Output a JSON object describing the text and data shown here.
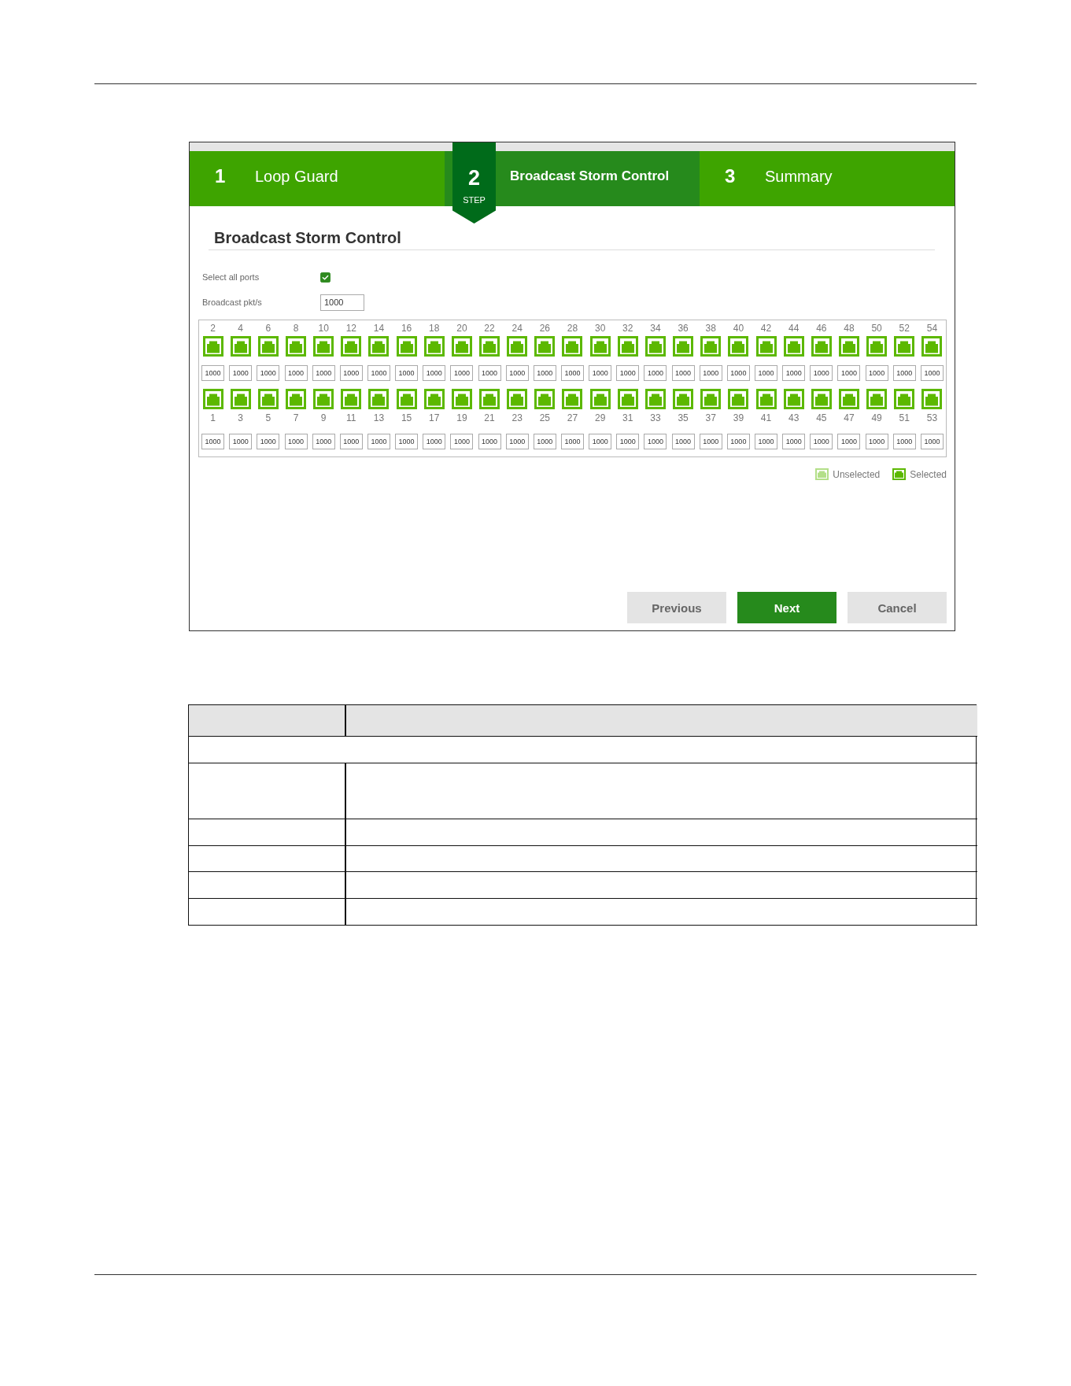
{
  "step_caption": "STEP",
  "steps": [
    {
      "number": "1",
      "label": "Loop Guard",
      "selected": false
    },
    {
      "number": "2",
      "label": "Broadcast Storm Control",
      "selected": true
    },
    {
      "number": "3",
      "label": "Summary",
      "selected": false
    }
  ],
  "section_title": "Broadcast Storm Control",
  "select_all": {
    "label": "Select all ports",
    "checked": true
  },
  "broadcast_rate": {
    "label": "Broadcast pkt/s",
    "value": "1000"
  },
  "port_rows": [
    {
      "kind": "upper",
      "ports": [
        {
          "number": "2",
          "value": "1000",
          "selected": true
        },
        {
          "number": "4",
          "value": "1000",
          "selected": true
        },
        {
          "number": "6",
          "value": "1000",
          "selected": true
        },
        {
          "number": "8",
          "value": "1000",
          "selected": true
        },
        {
          "number": "10",
          "value": "1000",
          "selected": true
        },
        {
          "number": "12",
          "value": "1000",
          "selected": true
        },
        {
          "number": "14",
          "value": "1000",
          "selected": true
        },
        {
          "number": "16",
          "value": "1000",
          "selected": true
        },
        {
          "number": "18",
          "value": "1000",
          "selected": true
        },
        {
          "number": "20",
          "value": "1000",
          "selected": true
        },
        {
          "number": "22",
          "value": "1000",
          "selected": true
        },
        {
          "number": "24",
          "value": "1000",
          "selected": true
        },
        {
          "number": "26",
          "value": "1000",
          "selected": true
        },
        {
          "number": "28",
          "value": "1000",
          "selected": true
        },
        {
          "number": "30",
          "value": "1000",
          "selected": true
        },
        {
          "number": "32",
          "value": "1000",
          "selected": true
        },
        {
          "number": "34",
          "value": "1000",
          "selected": true
        },
        {
          "number": "36",
          "value": "1000",
          "selected": true
        },
        {
          "number": "38",
          "value": "1000",
          "selected": true
        },
        {
          "number": "40",
          "value": "1000",
          "selected": true
        },
        {
          "number": "42",
          "value": "1000",
          "selected": true
        },
        {
          "number": "44",
          "value": "1000",
          "selected": true
        },
        {
          "number": "46",
          "value": "1000",
          "selected": true
        },
        {
          "number": "48",
          "value": "1000",
          "selected": true
        },
        {
          "number": "50",
          "value": "1000",
          "selected": true
        },
        {
          "number": "52",
          "value": "1000",
          "selected": true
        },
        {
          "number": "54",
          "value": "1000",
          "selected": true
        }
      ]
    },
    {
      "kind": "lower",
      "ports": [
        {
          "number": "1",
          "value": "1000",
          "selected": true
        },
        {
          "number": "3",
          "value": "1000",
          "selected": true
        },
        {
          "number": "5",
          "value": "1000",
          "selected": true
        },
        {
          "number": "7",
          "value": "1000",
          "selected": true
        },
        {
          "number": "9",
          "value": "1000",
          "selected": true
        },
        {
          "number": "11",
          "value": "1000",
          "selected": true
        },
        {
          "number": "13",
          "value": "1000",
          "selected": true
        },
        {
          "number": "15",
          "value": "1000",
          "selected": true
        },
        {
          "number": "17",
          "value": "1000",
          "selected": true
        },
        {
          "number": "19",
          "value": "1000",
          "selected": true
        },
        {
          "number": "21",
          "value": "1000",
          "selected": true
        },
        {
          "number": "23",
          "value": "1000",
          "selected": true
        },
        {
          "number": "25",
          "value": "1000",
          "selected": true
        },
        {
          "number": "27",
          "value": "1000",
          "selected": true
        },
        {
          "number": "29",
          "value": "1000",
          "selected": true
        },
        {
          "number": "31",
          "value": "1000",
          "selected": true
        },
        {
          "number": "33",
          "value": "1000",
          "selected": true
        },
        {
          "number": "35",
          "value": "1000",
          "selected": true
        },
        {
          "number": "37",
          "value": "1000",
          "selected": true
        },
        {
          "number": "39",
          "value": "1000",
          "selected": true
        },
        {
          "number": "41",
          "value": "1000",
          "selected": true
        },
        {
          "number": "43",
          "value": "1000",
          "selected": true
        },
        {
          "number": "45",
          "value": "1000",
          "selected": true
        },
        {
          "number": "47",
          "value": "1000",
          "selected": true
        },
        {
          "number": "49",
          "value": "1000",
          "selected": true
        },
        {
          "number": "51",
          "value": "1000",
          "selected": true
        },
        {
          "number": "53",
          "value": "1000",
          "selected": true
        }
      ]
    }
  ],
  "legend": [
    {
      "label": "Unselected",
      "kind": "unselected"
    },
    {
      "label": "Selected",
      "kind": "selected"
    }
  ],
  "buttons": [
    {
      "label": "Previous",
      "kind": "secondary"
    },
    {
      "label": "Next",
      "kind": "primary"
    },
    {
      "label": "Cancel",
      "kind": "secondary"
    }
  ]
}
